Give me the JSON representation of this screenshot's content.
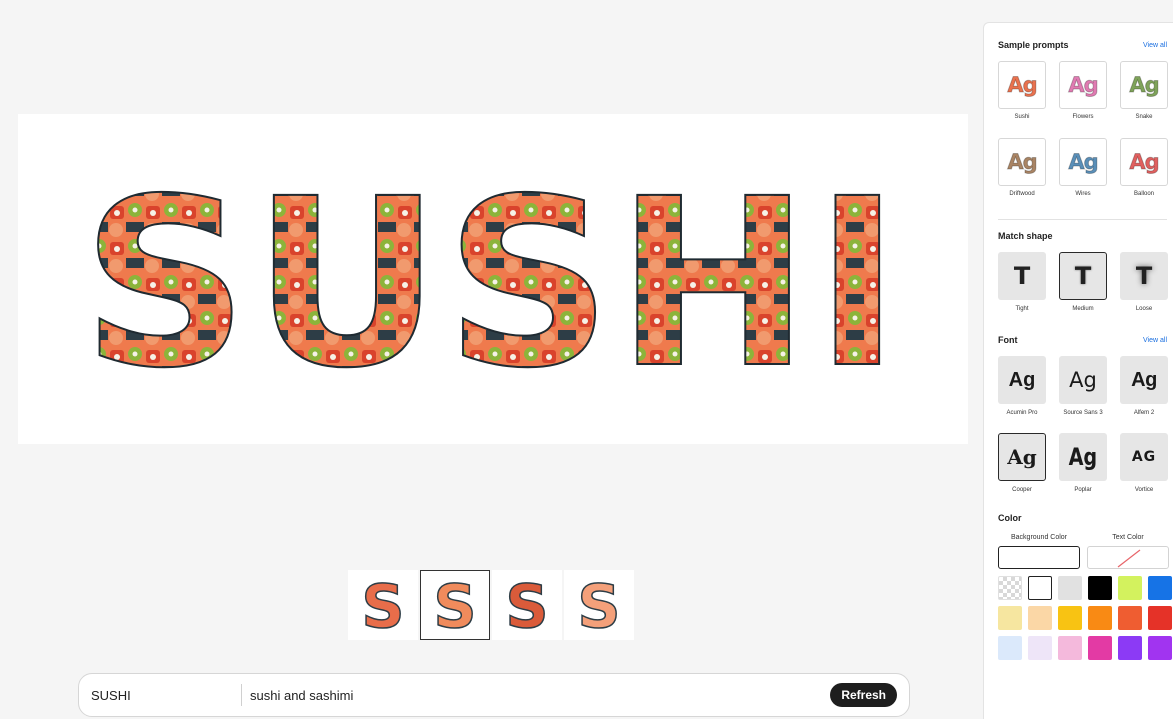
{
  "canvas": {
    "word": "SUSHI",
    "colors": [
      "#ef7a4d",
      "#2d3d46",
      "#f19a6e",
      "#8cb43a",
      "#d9432c",
      "#f6f1e6",
      "#1f2a31"
    ]
  },
  "variations": {
    "letter": "S",
    "items": [
      {
        "fill": "#e86d4a",
        "selected": false
      },
      {
        "fill": "#f08b5c",
        "selected": true
      },
      {
        "fill": "#da5b3a",
        "selected": false
      },
      {
        "fill": "#f4a07a",
        "selected": false
      }
    ]
  },
  "prompt": {
    "text": "SUSHI",
    "style": "sushi and sashimi",
    "refresh_label": "Refresh"
  },
  "panel": {
    "sample_prompts": {
      "title": "Sample prompts",
      "view_all": "View all",
      "glyph": "Ag",
      "items": [
        {
          "label": "Sushi",
          "color": "#e9724f"
        },
        {
          "label": "Flowers",
          "color": "#e07bb2"
        },
        {
          "label": "Snake",
          "color": "#7fa35a"
        },
        {
          "label": "Driftwood",
          "color": "#a98464"
        },
        {
          "label": "Wires",
          "color": "#5a8fb8"
        },
        {
          "label": "Balloon",
          "color": "#e0605f"
        }
      ]
    },
    "match_shape": {
      "title": "Match shape",
      "glyph": "T",
      "items": [
        {
          "label": "Tight",
          "selected": false
        },
        {
          "label": "Medium",
          "selected": true
        },
        {
          "label": "Loose",
          "selected": false
        }
      ]
    },
    "font": {
      "title": "Font",
      "view_all": "View all",
      "items": [
        {
          "label": "Acumin Pro",
          "glyph": "Ag",
          "selected": false
        },
        {
          "label": "Source Sans 3",
          "glyph": "Ag",
          "selected": false
        },
        {
          "label": "Alfem 2",
          "glyph": "Ag",
          "selected": false
        },
        {
          "label": "Cooper",
          "glyph": "Ag",
          "selected": true
        },
        {
          "label": "Poplar",
          "glyph": "Ag",
          "selected": false
        },
        {
          "label": "Vortice",
          "glyph": "AG",
          "selected": false
        }
      ]
    },
    "color": {
      "title": "Color",
      "background_label": "Background Color",
      "text_label": "Text Color",
      "background_value": "#ffffff",
      "swatches": [
        "transparent",
        "#ffffff",
        "#e1e1e1",
        "#000000",
        "#d3f25e",
        "#1673e6",
        "#f6e6a0",
        "#fbd7a6",
        "#f8c313",
        "#f98a14",
        "#ef5d31",
        "#e53228",
        "#dbe9fb",
        "#eee5f8",
        "#f4b9dc",
        "#e33aa4",
        "#8c3af5",
        "#a134f0"
      ],
      "selected_swatch": 1
    }
  }
}
